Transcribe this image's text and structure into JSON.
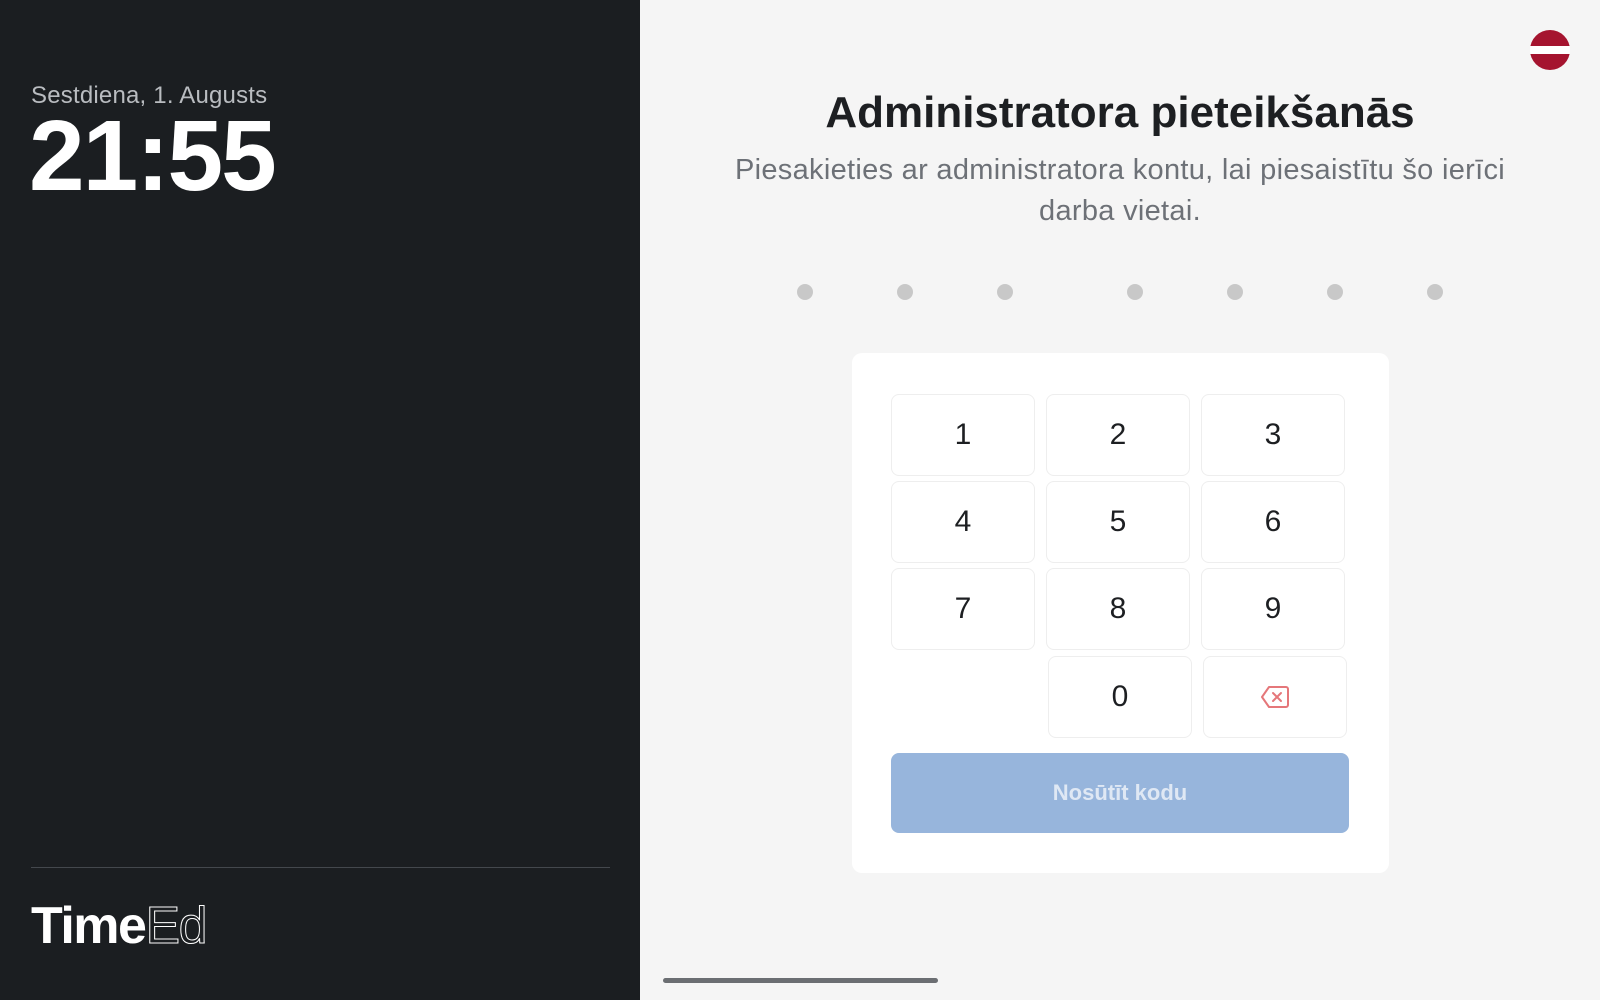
{
  "sidebar": {
    "date": "Sestdiena, 1. Augusts",
    "time": "21:55",
    "logo_bold": "Time",
    "logo_thin": "Ed"
  },
  "header": {
    "title": "Administratora pieteikšanās",
    "subtitle": "Piesakieties ar administratora kontu, lai piesaistītu šo ierīci darba vietai."
  },
  "language": {
    "flag_icon": "latvia-flag-icon"
  },
  "code_entry": {
    "length": 7,
    "filled": 0
  },
  "keypad": {
    "keys": [
      "1",
      "2",
      "3",
      "4",
      "5",
      "6",
      "7",
      "8",
      "9",
      "0"
    ],
    "backspace_icon": "backspace-icon"
  },
  "submit": {
    "label": "Nosūtīt kodu",
    "enabled": false
  },
  "colors": {
    "sidebar_bg": "#1b1e21",
    "content_bg": "#f5f5f5",
    "button_disabled": "#97b5dc",
    "backspace_icon": "#e5777a",
    "flag_red": "#a5142f"
  }
}
